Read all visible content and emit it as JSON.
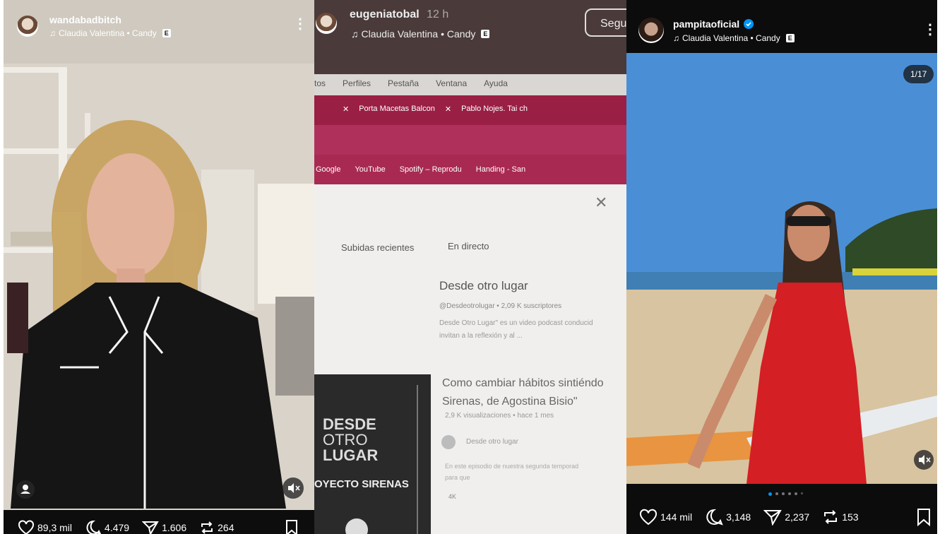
{
  "posts": [
    {
      "username": "wandabadbitch",
      "song": "Claudia Valentina • Candy",
      "explicit": "E",
      "likes": "89,3 mil",
      "comments": "4.479",
      "shares": "1.606",
      "reposts": "264"
    },
    {
      "username": "eugeniatobal",
      "time": "12 h",
      "song": "Claudia Valentina • Candy",
      "explicit": "E",
      "follow_label": "Segu",
      "screen": {
        "menu": [
          "tos",
          "Perfiles",
          "Pestaña",
          "Ventana",
          "Ayuda"
        ],
        "tabs": [
          "Porta Macetas Balcon",
          "Pablo Nojes. Tai ch"
        ],
        "bookmarks": [
          "Google",
          "YouTube",
          "Spotify – Reprodu",
          "Handing - San"
        ],
        "filters": [
          "Subidas recientes",
          "En directo"
        ],
        "channel_title": "Desde otro lugar",
        "channel_meta": "@Desdeotrolugar • 2,09 K suscriptores",
        "channel_desc1": "Desde Otro Lugar\" es un video podcast conducid",
        "channel_desc2": "invitan a la reflexión y al ...",
        "video_title1": "Como cambiar hábitos sintiéndo",
        "video_title2": "Sirenas, de Agostina Bisio\"",
        "video_meta": "2,9 K visualizaciones • hace 1 mes",
        "video_channel": "Desde otro lugar",
        "video_desc1": "En este episodio de nuestra segunda temporad",
        "video_desc2": "para que",
        "video_quality": "4K",
        "thumb_line1": "DESDE",
        "thumb_line2": "OTRO",
        "thumb_line3": "LUGAR",
        "thumb_footer": "OYECTO SIRENAS"
      }
    },
    {
      "username": "pampitaoficial",
      "verified": true,
      "song": "Claudia Valentina • Candy",
      "explicit": "E",
      "carousel": "1/17",
      "likes": "144 mil",
      "comments": "3,148",
      "shares": "2,237",
      "reposts": "153"
    }
  ],
  "colors": {
    "verified": "#0095f6",
    "browser_bar": "#b0305c",
    "dress": "#d41f24",
    "sky": "#4a8fd6",
    "sand": "#d8c4a0"
  },
  "icons": [
    "music-note-icon",
    "kebab-menu-icon",
    "heart-icon",
    "comment-icon",
    "share-icon",
    "repost-icon",
    "bookmark-icon",
    "mute-icon",
    "tagged-user-icon",
    "close-icon",
    "verified-icon"
  ]
}
